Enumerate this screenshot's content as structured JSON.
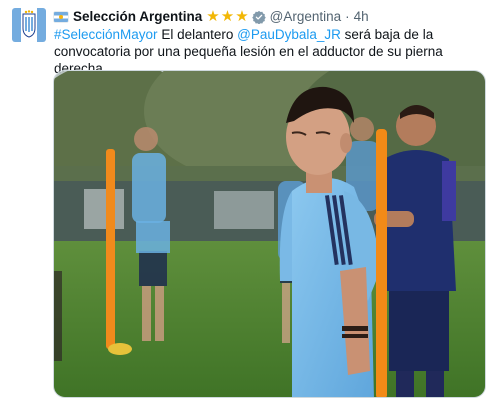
{
  "tweet": {
    "display_name": "Selección Argentina",
    "handle": "@Argentina",
    "separator": "·",
    "time": "4h",
    "text_parts": {
      "hashtag": "#SelecciónMayor",
      "t1": " El delantero ",
      "mention": "@PauDybala_JR",
      "t2": " será baja de la convocatoria por una pequeña lesión en el adductor de su pierna derecha."
    },
    "badge_icons": [
      "flag-icon",
      "star-icon",
      "star-icon",
      "star-icon",
      "verified-badge-icon"
    ],
    "image_description_icon": "photo"
  },
  "colors": {
    "link": "#1d9bf0",
    "muted": "#536471",
    "star": "#f2b705",
    "argentina_blue": "#74acdf"
  }
}
